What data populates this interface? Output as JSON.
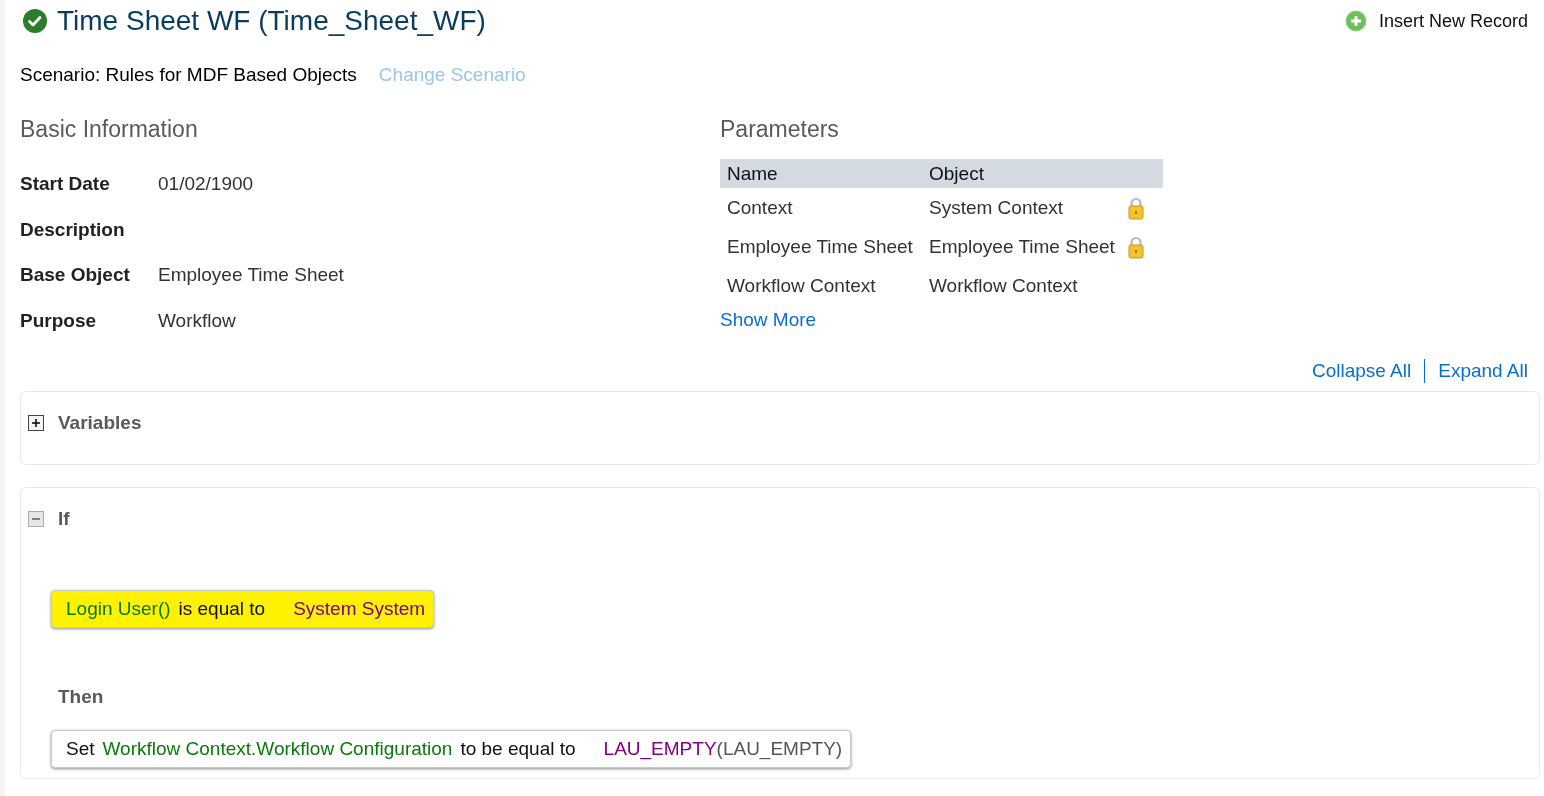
{
  "header": {
    "title": "Time Sheet WF (Time_Sheet_WF)",
    "action": "Insert New Record"
  },
  "scenario": {
    "label": "Scenario: Rules for MDF Based Objects",
    "link": "Change Scenario"
  },
  "basic_information": {
    "heading": "Basic Information",
    "fields": [
      {
        "label": "Start Date",
        "value": "01/02/1900"
      },
      {
        "label": "Description"
      },
      {
        "label": "Base Object",
        "value": "Employee Time Sheet"
      },
      {
        "label": "Purpose",
        "value": "Workflow"
      }
    ]
  },
  "parameters": {
    "heading": "Parameters",
    "columns": [
      "Name",
      "Object"
    ],
    "rows": [
      {
        "name": "Context",
        "object": "System Context",
        "locked": true
      },
      {
        "name": "Employee Time Sheet",
        "object": "Employee Time Sheet",
        "locked": true
      },
      {
        "name": "Workflow Context",
        "object": "Workflow Context",
        "locked": false
      }
    ],
    "show_more": "Show More"
  },
  "toolbar": {
    "collapse": "Collapse All",
    "expand": "Expand All"
  },
  "sections": [
    {
      "title": "Variables",
      "expanded": false
    },
    {
      "title": "If",
      "expanded": true,
      "condition": [
        {
          "kind": "field",
          "text": "Login User()"
        },
        {
          "kind": "text",
          "text": "is equal to"
        },
        {
          "kind": "value",
          "text": "System System"
        }
      ],
      "then_label": "Then",
      "action": [
        {
          "kind": "text",
          "text": "Set"
        },
        {
          "kind": "field",
          "text": "Workflow Context.Workflow Configuration"
        },
        {
          "kind": "text",
          "text": "to be equal to"
        },
        {
          "kind": "value",
          "text": "LAU_EMPTY"
        },
        {
          "kind": "paren",
          "text": "(LAU_EMPTY)"
        }
      ]
    }
  ]
}
